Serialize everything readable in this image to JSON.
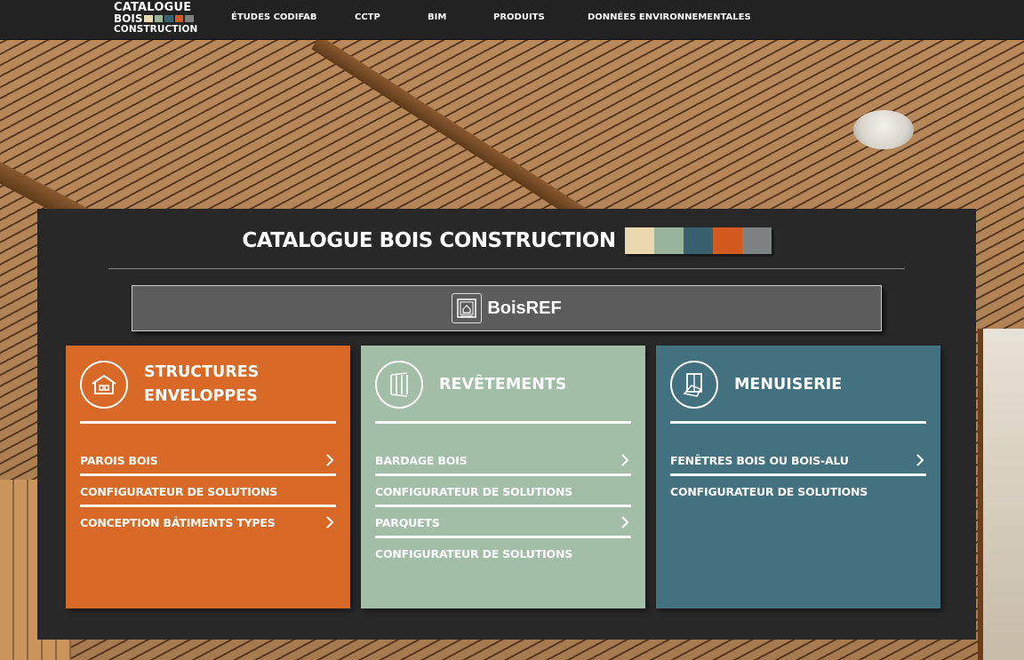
{
  "header": {
    "logo": {
      "line1": "CATALOGUE",
      "line2": "BOIS",
      "line3": "CONSTRUCTION"
    },
    "nav": [
      {
        "label": "ÉTUDES CODIFAB"
      },
      {
        "label": "CCTP"
      },
      {
        "label": "BIM"
      },
      {
        "label": "PRODUITS"
      },
      {
        "label": "DONNÉES ENVIRONNEMENTALES"
      }
    ]
  },
  "colors": {
    "swatches": [
      "#e9d8ad",
      "#98b59c",
      "#38606f",
      "#d4591f",
      "#7c8282"
    ],
    "structures": "#d86927",
    "revetements": "#a2bea6",
    "menuiserie": "#437180",
    "panel": "#282828",
    "topbar": "#222222"
  },
  "panel": {
    "title": "CATALOGUE BOIS CONSTRUCTION",
    "boisref": {
      "label": "BoisREF",
      "icon": "boisref-book-icon"
    }
  },
  "cards": [
    {
      "icon": "house-icon",
      "title_line1": "STRUCTURES",
      "title_line2": "ENVELOPPES",
      "items": [
        {
          "label": "PAROIS BOIS",
          "chevron": true
        },
        {
          "label": "CONFIGURATEUR DE SOLUTIONS",
          "chevron": false
        },
        {
          "label": "CONCEPTION BÂTIMENTS TYPES",
          "chevron": true
        }
      ]
    },
    {
      "icon": "cladding-icon",
      "title_line1": "REVÊTEMENTS",
      "items": [
        {
          "label": "BARDAGE BOIS",
          "chevron": true
        },
        {
          "label": "CONFIGURATEUR DE SOLUTIONS",
          "chevron": false
        },
        {
          "label": "PARQUETS",
          "chevron": true
        },
        {
          "label": "CONFIGURATEUR DE SOLUTIONS",
          "chevron": false
        }
      ]
    },
    {
      "icon": "window-icon",
      "title_line1": "MENUISERIE",
      "items": [
        {
          "label": "FENÊTRES BOIS OU BOIS-ALU",
          "chevron": true
        },
        {
          "label": "CONFIGURATEUR DE SOLUTIONS",
          "chevron": false
        }
      ]
    }
  ]
}
